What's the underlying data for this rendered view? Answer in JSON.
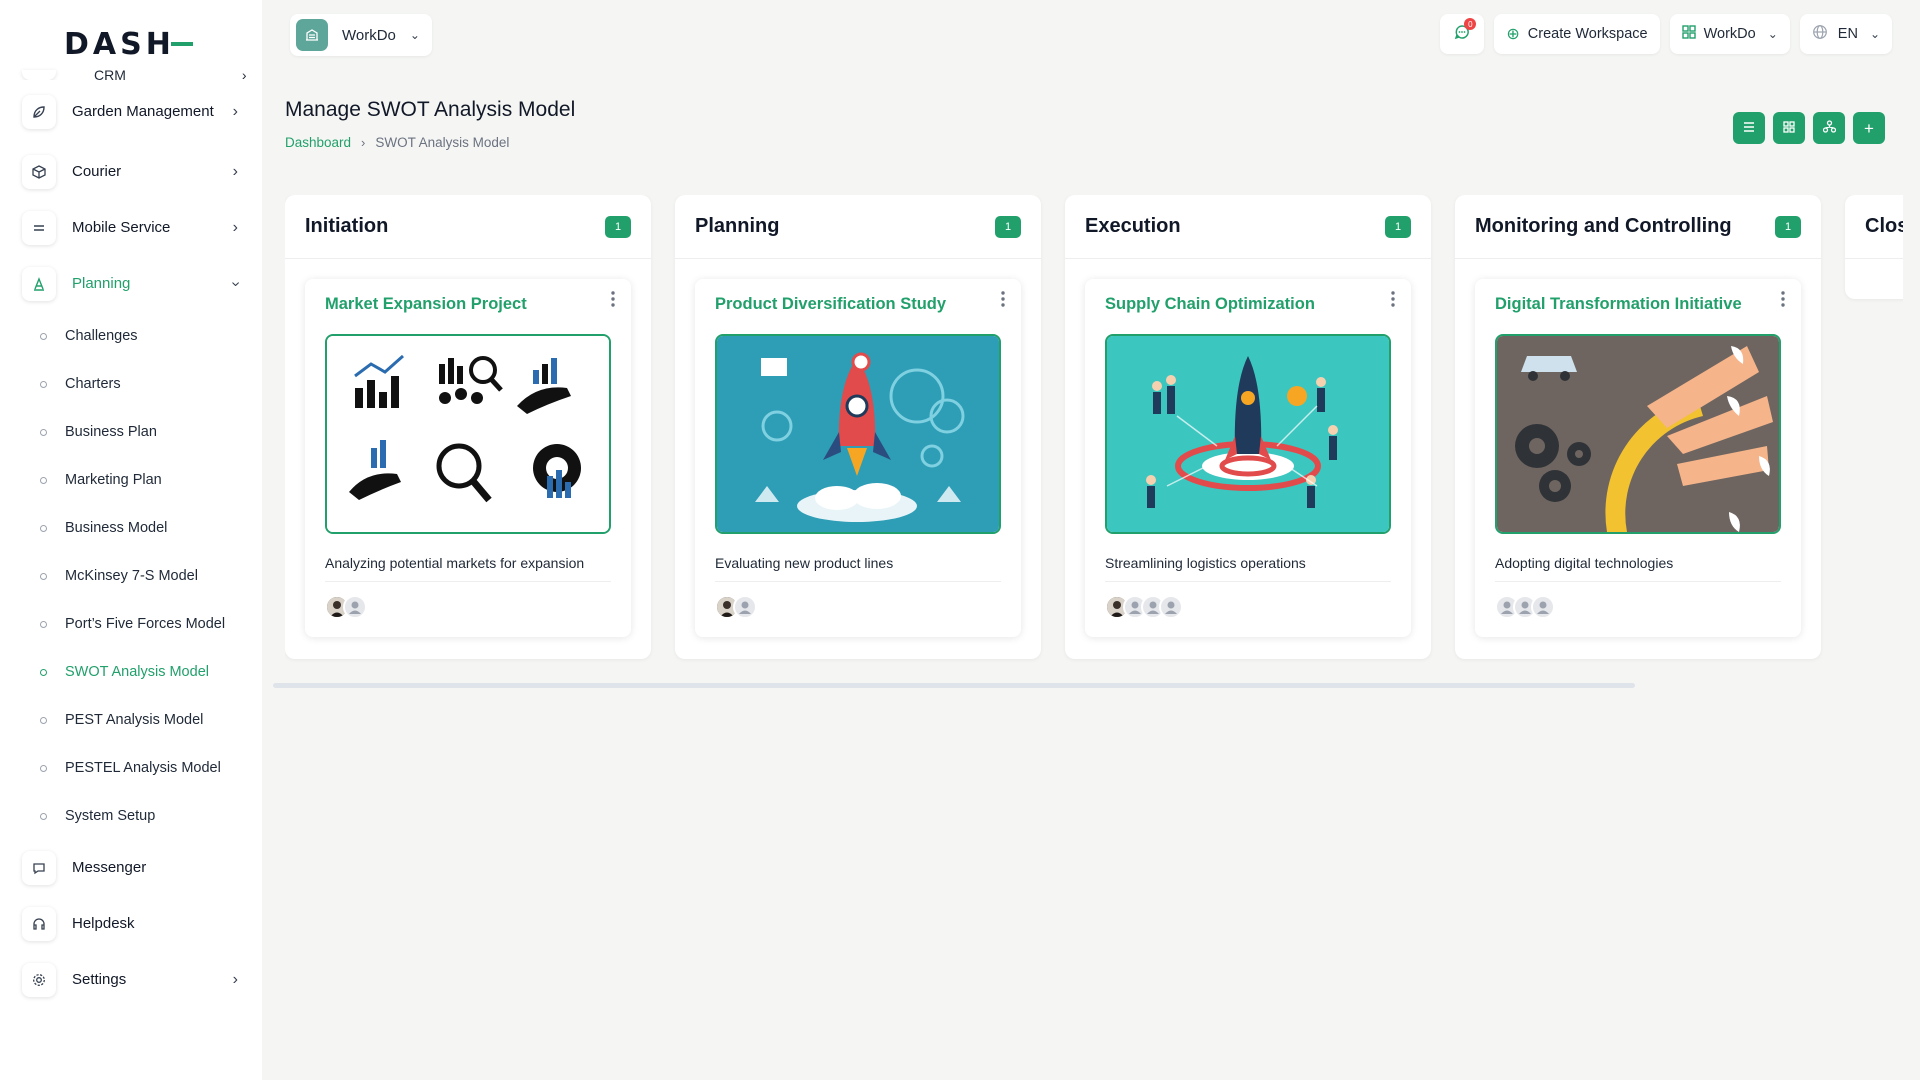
{
  "app": {
    "logo_text": "DASH",
    "workspace_selector": "WorkDo"
  },
  "header": {
    "notification_count": "0",
    "create_workspace": "Create Workspace",
    "workspace_menu": "WorkDo",
    "language": "EN"
  },
  "sidebar": {
    "cut_item": "CRM",
    "main_items_top": [
      {
        "label": "Garden Management",
        "icon": "leaf-icon"
      },
      {
        "label": "Courier",
        "icon": "box-icon"
      },
      {
        "label": "Mobile Service",
        "icon": "menu-lines-icon"
      },
      {
        "label": "Planning",
        "icon": "planning-icon"
      }
    ],
    "sub_items": [
      "Challenges",
      "Charters",
      "Business Plan",
      "Marketing Plan",
      "Business Model",
      "McKinsey 7-S Model",
      "Port’s Five Forces Model",
      "SWOT Analysis Model",
      "PEST Analysis Model",
      "PESTEL Analysis Model",
      "System Setup"
    ],
    "main_items_bottom": [
      {
        "label": "Messenger",
        "icon": "chat-icon"
      },
      {
        "label": "Helpdesk",
        "icon": "headset-icon"
      },
      {
        "label": "Settings",
        "icon": "gear-icon"
      }
    ],
    "active_sub": "SWOT Analysis Model"
  },
  "page": {
    "title": "Manage SWOT Analysis Model",
    "breadcrumb": {
      "home": "Dashboard",
      "current": "SWOT Analysis Model"
    }
  },
  "board": {
    "columns": [
      {
        "title": "Initiation",
        "count": "1",
        "card": {
          "title": "Market Expansion Project",
          "description": "Analyzing potential markets for expansion",
          "image": "business-icons-illustration",
          "assignees": 2
        }
      },
      {
        "title": "Planning",
        "count": "1",
        "card": {
          "title": "Product Diversification Study",
          "description": "Evaluating new product lines",
          "image": "rocket-launch-illustration",
          "assignees": 2
        }
      },
      {
        "title": "Execution",
        "count": "1",
        "card": {
          "title": "Supply Chain Optimization",
          "description": "Streamlining logistics operations",
          "image": "team-rocket-illustration",
          "assignees": 4
        }
      },
      {
        "title": "Monitoring and Controlling",
        "count": "1",
        "card": {
          "title": "Digital Transformation Initiative",
          "description": "Adopting digital technologies",
          "image": "gears-paper-illustration",
          "assignees": 3
        }
      },
      {
        "title": "Clos",
        "count": "",
        "card": null
      }
    ]
  },
  "colors": {
    "accent": "#22a06b",
    "background": "#f5f6f4"
  }
}
